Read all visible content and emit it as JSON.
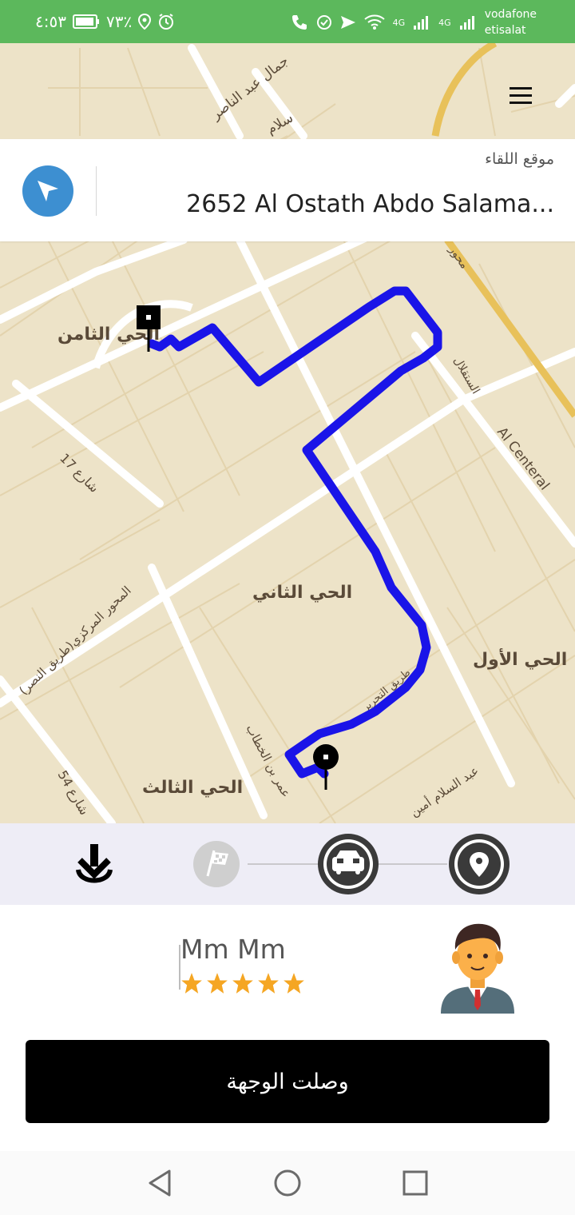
{
  "status_bar": {
    "time": "٤:٥٣",
    "battery": "٧٣٪",
    "carrier_1": "vodafone",
    "carrier_2": "etisalat",
    "network_1": "4G",
    "network_2": "4G",
    "colors": {
      "background": "#5cb85c"
    }
  },
  "header": {
    "menu_icon": "hamburger-menu-icon"
  },
  "pickup": {
    "label": "موقع اللقاء",
    "address": "2652 Al Ostath Abdo Salama...",
    "nav_icon": "navigation-arrow-icon"
  },
  "map": {
    "labels": {
      "top_street": "جمال عبد الناصر",
      "top_street_2": "سلام",
      "district_8": "الحي الثامن",
      "district_2": "الحي الثاني",
      "district_1": "الحي الأول",
      "district_3": "الحي الثالث",
      "street_17": "شارع 17",
      "street_54": "شارع 54",
      "central_axis": "المحور المركزي(طريق النصر)",
      "al_central": "Al Centeral",
      "istiqlal": "الستقلال",
      "mehwar": "محور",
      "tahrir": "طريق التحرير",
      "omar": "عمر بن الخطاب",
      "abdelsalam": "عبد السلام أمين"
    },
    "route_color": "#1a14e8"
  },
  "trip_progress": {
    "steps": [
      "download-arrow-icon",
      "finish-flag-icon",
      "car-icon",
      "location-pin-icon"
    ]
  },
  "driver": {
    "name": "Mm Mm",
    "rating": 5,
    "avatar_icon": "driver-avatar-icon",
    "star_color": "#f5a623"
  },
  "action": {
    "label": "وصلت الوجهة"
  },
  "navbar": {
    "icons": [
      "back-icon",
      "home-icon",
      "recents-icon"
    ]
  }
}
